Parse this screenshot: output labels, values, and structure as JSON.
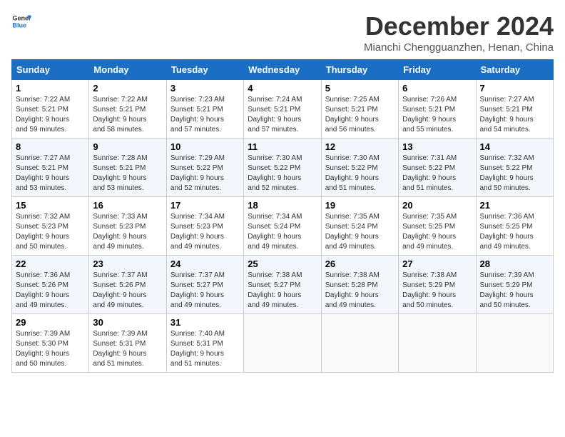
{
  "logo": {
    "line1": "General",
    "line2": "Blue"
  },
  "title": "December 2024",
  "location": "Mianchi Chengguanzhen, Henan, China",
  "weekdays": [
    "Sunday",
    "Monday",
    "Tuesday",
    "Wednesday",
    "Thursday",
    "Friday",
    "Saturday"
  ],
  "weeks": [
    [
      {
        "day": 1,
        "info": "Sunrise: 7:22 AM\nSunset: 5:21 PM\nDaylight: 9 hours\nand 59 minutes."
      },
      {
        "day": 2,
        "info": "Sunrise: 7:22 AM\nSunset: 5:21 PM\nDaylight: 9 hours\nand 58 minutes."
      },
      {
        "day": 3,
        "info": "Sunrise: 7:23 AM\nSunset: 5:21 PM\nDaylight: 9 hours\nand 57 minutes."
      },
      {
        "day": 4,
        "info": "Sunrise: 7:24 AM\nSunset: 5:21 PM\nDaylight: 9 hours\nand 57 minutes."
      },
      {
        "day": 5,
        "info": "Sunrise: 7:25 AM\nSunset: 5:21 PM\nDaylight: 9 hours\nand 56 minutes."
      },
      {
        "day": 6,
        "info": "Sunrise: 7:26 AM\nSunset: 5:21 PM\nDaylight: 9 hours\nand 55 minutes."
      },
      {
        "day": 7,
        "info": "Sunrise: 7:27 AM\nSunset: 5:21 PM\nDaylight: 9 hours\nand 54 minutes."
      }
    ],
    [
      {
        "day": 8,
        "info": "Sunrise: 7:27 AM\nSunset: 5:21 PM\nDaylight: 9 hours\nand 53 minutes."
      },
      {
        "day": 9,
        "info": "Sunrise: 7:28 AM\nSunset: 5:21 PM\nDaylight: 9 hours\nand 53 minutes."
      },
      {
        "day": 10,
        "info": "Sunrise: 7:29 AM\nSunset: 5:22 PM\nDaylight: 9 hours\nand 52 minutes."
      },
      {
        "day": 11,
        "info": "Sunrise: 7:30 AM\nSunset: 5:22 PM\nDaylight: 9 hours\nand 52 minutes."
      },
      {
        "day": 12,
        "info": "Sunrise: 7:30 AM\nSunset: 5:22 PM\nDaylight: 9 hours\nand 51 minutes."
      },
      {
        "day": 13,
        "info": "Sunrise: 7:31 AM\nSunset: 5:22 PM\nDaylight: 9 hours\nand 51 minutes."
      },
      {
        "day": 14,
        "info": "Sunrise: 7:32 AM\nSunset: 5:22 PM\nDaylight: 9 hours\nand 50 minutes."
      }
    ],
    [
      {
        "day": 15,
        "info": "Sunrise: 7:32 AM\nSunset: 5:23 PM\nDaylight: 9 hours\nand 50 minutes."
      },
      {
        "day": 16,
        "info": "Sunrise: 7:33 AM\nSunset: 5:23 PM\nDaylight: 9 hours\nand 49 minutes."
      },
      {
        "day": 17,
        "info": "Sunrise: 7:34 AM\nSunset: 5:23 PM\nDaylight: 9 hours\nand 49 minutes."
      },
      {
        "day": 18,
        "info": "Sunrise: 7:34 AM\nSunset: 5:24 PM\nDaylight: 9 hours\nand 49 minutes."
      },
      {
        "day": 19,
        "info": "Sunrise: 7:35 AM\nSunset: 5:24 PM\nDaylight: 9 hours\nand 49 minutes."
      },
      {
        "day": 20,
        "info": "Sunrise: 7:35 AM\nSunset: 5:25 PM\nDaylight: 9 hours\nand 49 minutes."
      },
      {
        "day": 21,
        "info": "Sunrise: 7:36 AM\nSunset: 5:25 PM\nDaylight: 9 hours\nand 49 minutes."
      }
    ],
    [
      {
        "day": 22,
        "info": "Sunrise: 7:36 AM\nSunset: 5:26 PM\nDaylight: 9 hours\nand 49 minutes."
      },
      {
        "day": 23,
        "info": "Sunrise: 7:37 AM\nSunset: 5:26 PM\nDaylight: 9 hours\nand 49 minutes."
      },
      {
        "day": 24,
        "info": "Sunrise: 7:37 AM\nSunset: 5:27 PM\nDaylight: 9 hours\nand 49 minutes."
      },
      {
        "day": 25,
        "info": "Sunrise: 7:38 AM\nSunset: 5:27 PM\nDaylight: 9 hours\nand 49 minutes."
      },
      {
        "day": 26,
        "info": "Sunrise: 7:38 AM\nSunset: 5:28 PM\nDaylight: 9 hours\nand 49 minutes."
      },
      {
        "day": 27,
        "info": "Sunrise: 7:38 AM\nSunset: 5:29 PM\nDaylight: 9 hours\nand 50 minutes."
      },
      {
        "day": 28,
        "info": "Sunrise: 7:39 AM\nSunset: 5:29 PM\nDaylight: 9 hours\nand 50 minutes."
      }
    ],
    [
      {
        "day": 29,
        "info": "Sunrise: 7:39 AM\nSunset: 5:30 PM\nDaylight: 9 hours\nand 50 minutes."
      },
      {
        "day": 30,
        "info": "Sunrise: 7:39 AM\nSunset: 5:31 PM\nDaylight: 9 hours\nand 51 minutes."
      },
      {
        "day": 31,
        "info": "Sunrise: 7:40 AM\nSunset: 5:31 PM\nDaylight: 9 hours\nand 51 minutes."
      },
      null,
      null,
      null,
      null
    ]
  ]
}
